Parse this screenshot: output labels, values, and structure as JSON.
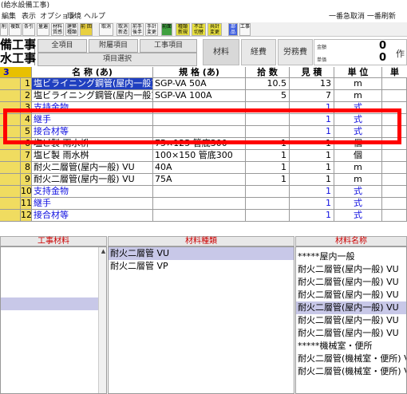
{
  "window": {
    "title": "(給水設備工事)"
  },
  "menu": [
    "編集",
    "表示",
    "オプション",
    "環境",
    "ヘルプ"
  ],
  "menu_right": "一番急取消 一番刷新",
  "toolbar": [
    "削",
    "複数",
    "条引",
    "量遍",
    "材料 質感",
    "建築 種類",
    "前 回",
    "取消",
    "取消 新造",
    "前手 後手",
    "手計 変更",
    "前面",
    "種類 新規",
    "不正 切替",
    "共計 変更",
    "部品",
    "工事"
  ],
  "header": {
    "left_line1": "備工事",
    "left_line2": "水工事",
    "btn_all": "全項目",
    "btn_attached": "附屬項目",
    "btn_work": "工事項目",
    "btn_select": "項目選択",
    "cat_material": "材料",
    "cat_expense": "経費",
    "cat_labor": "労務費",
    "sum_label1": "金額",
    "sum_label2": "単価",
    "sum_val1": "0",
    "sum_val2": "0",
    "sum_ext1": "作",
    "sum_ext2": ""
  },
  "grid": {
    "corner": "3",
    "columns": [
      "名 称 (あ)",
      "規 格 (あ)",
      "拾 数",
      "見 積",
      "単 位",
      "単"
    ],
    "rows": [
      {
        "no": "1",
        "name": "塩ビライニング鋼管(屋内一般)",
        "spec": "SGP-VA 50A",
        "qty": "10.5",
        "est": "13",
        "unit": "m",
        "blue": false,
        "selected": true
      },
      {
        "no": "2",
        "name": "塩ビライニング鋼管(屋内一般)",
        "spec": "SGP-VA 100A",
        "qty": "5",
        "est": "7",
        "unit": "m",
        "blue": false,
        "selected": false
      },
      {
        "no": "3",
        "name": "支持金物",
        "spec": "",
        "qty": "",
        "est": "1",
        "unit": "式",
        "blue": true,
        "selected": false
      },
      {
        "no": "4",
        "name": "継手",
        "spec": "",
        "qty": "",
        "est": "1",
        "unit": "式",
        "blue": true,
        "selected": false
      },
      {
        "no": "5",
        "name": "接合材等",
        "spec": "",
        "qty": "",
        "est": "1",
        "unit": "式",
        "blue": true,
        "selected": false
      },
      {
        "no": "6",
        "name": "塩ビ製 雨水枡",
        "spec": "75×125 管底300",
        "qty": "1",
        "est": "1",
        "unit": "個",
        "blue": false,
        "selected": false
      },
      {
        "no": "7",
        "name": "塩ビ製 雨水桝",
        "spec": "100×150 管底300",
        "qty": "1",
        "est": "1",
        "unit": "個",
        "blue": false,
        "selected": false
      },
      {
        "no": "8",
        "name": "耐火二層管(屋内一般) VU",
        "spec": "40A",
        "qty": "1",
        "est": "1",
        "unit": "m",
        "blue": false,
        "selected": false
      },
      {
        "no": "9",
        "name": "耐火二層管(屋内一般) VU",
        "spec": "75A",
        "qty": "1",
        "est": "1",
        "unit": "m",
        "blue": false,
        "selected": false
      },
      {
        "no": "10",
        "name": "支持金物",
        "spec": "",
        "qty": "",
        "est": "1",
        "unit": "式",
        "blue": true,
        "selected": false
      },
      {
        "no": "11",
        "name": "継手",
        "spec": "",
        "qty": "",
        "est": "1",
        "unit": "式",
        "blue": true,
        "selected": false
      },
      {
        "no": "12",
        "name": "接合材等",
        "spec": "",
        "qty": "",
        "est": "1",
        "unit": "式",
        "blue": true,
        "selected": false
      }
    ]
  },
  "panels": {
    "work_material_title": "工事材料",
    "material_type_title": "材料種類",
    "material_name_title": "材料名称",
    "material_types": [
      "耐火二層管 VU",
      "耐火二層管 VP"
    ],
    "material_names": [
      "*****屋内一般",
      "耐火二層管(屋内一般) VU",
      "耐火二層管(屋内一般) VU",
      "耐火二層管(屋内一般) VU",
      "耐火二層管(屋内一般) VU",
      "耐火二層管(屋内一般) VU",
      "耐火二層管(屋内一般) VU",
      "*****機械室・便所",
      "耐火二層管(機械室・便所) VU",
      "耐火二層管(機械室・便所) VU"
    ]
  },
  "colors": {
    "highlight": "#ff0000",
    "row_number_bg": "#f0dc60",
    "blue_text": "#1010e0",
    "title_red": "#cc0000"
  }
}
